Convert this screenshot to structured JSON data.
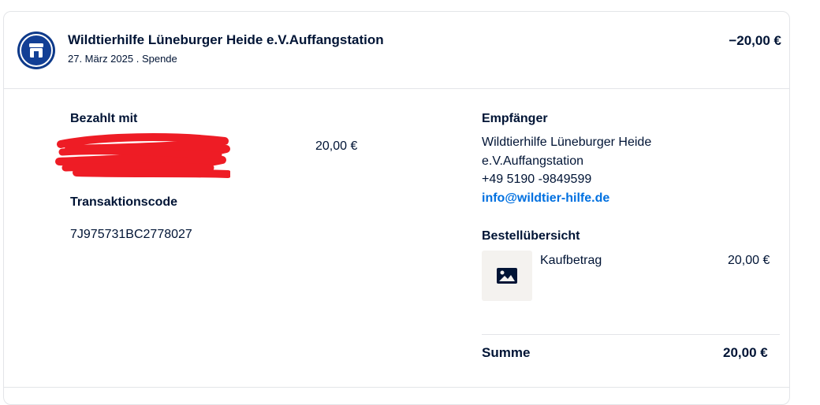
{
  "header": {
    "merchant_name": "Wildtierhilfe Lüneburger Heide e.V.Auffangstation",
    "subtitle": "27. März 2025 . Spende",
    "amount": "−20,00 €",
    "avatar_icon": "store-icon"
  },
  "payment": {
    "paid_with_label": "Bezahlt mit",
    "paid_amount": "20,00 €",
    "transaction_code_label": "Transaktionscode",
    "transaction_code": "7J975731BC2778027"
  },
  "recipient": {
    "label": "Empfänger",
    "name_line1": "Wildtierhilfe Lüneburger Heide",
    "name_line2": "e.V.Auffangstation",
    "phone": "+49 5190 -9849599",
    "email": "info@wildtier-hilfe.de"
  },
  "order": {
    "label": "Bestellübersicht",
    "item_icon": "image-placeholder-icon",
    "item_label": "Kaufbetrag",
    "item_amount": "20,00 €",
    "total_label": "Summe",
    "total_amount": "20,00 €"
  },
  "colors": {
    "text": "#001435",
    "link": "#0070e0",
    "avatar_bg": "#0e3a8a",
    "redaction": "#ee1c25",
    "border": "#e3e5e8"
  }
}
